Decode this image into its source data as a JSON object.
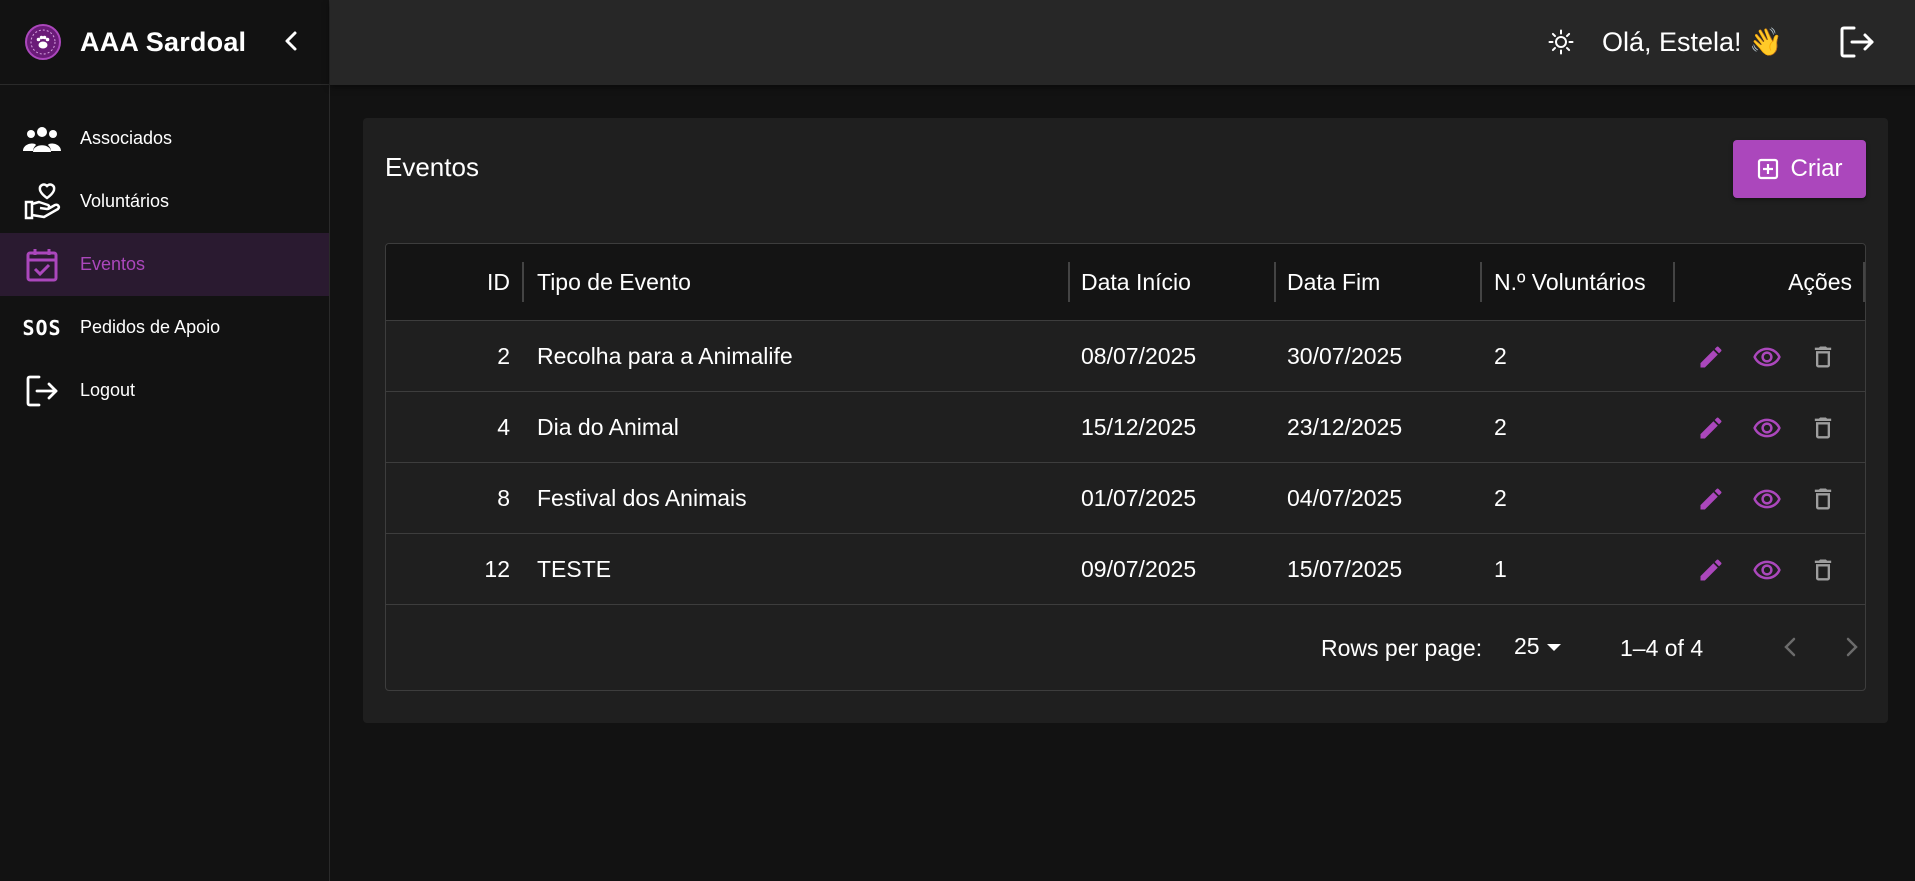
{
  "app": {
    "brand_title": "AAA Sardoal",
    "accent_color": "#ab47bc"
  },
  "sidebar": {
    "items": [
      {
        "label": "Associados",
        "icon": "group-icon"
      },
      {
        "label": "Voluntários",
        "icon": "heart-hand-icon"
      },
      {
        "label": "Eventos",
        "icon": "calendar-check-icon",
        "active": true
      },
      {
        "label": "Pedidos de Apoio",
        "icon": "sos-icon",
        "icon_text": "SOS"
      },
      {
        "label": "Logout",
        "icon": "logout-icon"
      }
    ]
  },
  "header": {
    "greeting": "Olá, Estela! 👋"
  },
  "main": {
    "title": "Eventos",
    "create_label": "Criar",
    "table": {
      "columns": [
        "ID",
        "Tipo de Evento",
        "Data Início",
        "Data Fim",
        "N.º Voluntários",
        "Ações"
      ],
      "rows": [
        {
          "id": "2",
          "tipo": "Recolha para a Animalife",
          "inicio": "08/07/2025",
          "fim": "30/07/2025",
          "voluntarios": "2"
        },
        {
          "id": "4",
          "tipo": "Dia do Animal",
          "inicio": "15/12/2025",
          "fim": "23/12/2025",
          "voluntarios": "2"
        },
        {
          "id": "8",
          "tipo": "Festival dos Animais",
          "inicio": "01/07/2025",
          "fim": "04/07/2025",
          "voluntarios": "2"
        },
        {
          "id": "12",
          "tipo": "TESTE",
          "inicio": "09/07/2025",
          "fim": "15/07/2025",
          "voluntarios": "1"
        }
      ]
    },
    "pagination": {
      "rows_per_page_label": "Rows per page:",
      "rows_per_page_value": "25",
      "range_text": "1–4 of 4"
    }
  }
}
